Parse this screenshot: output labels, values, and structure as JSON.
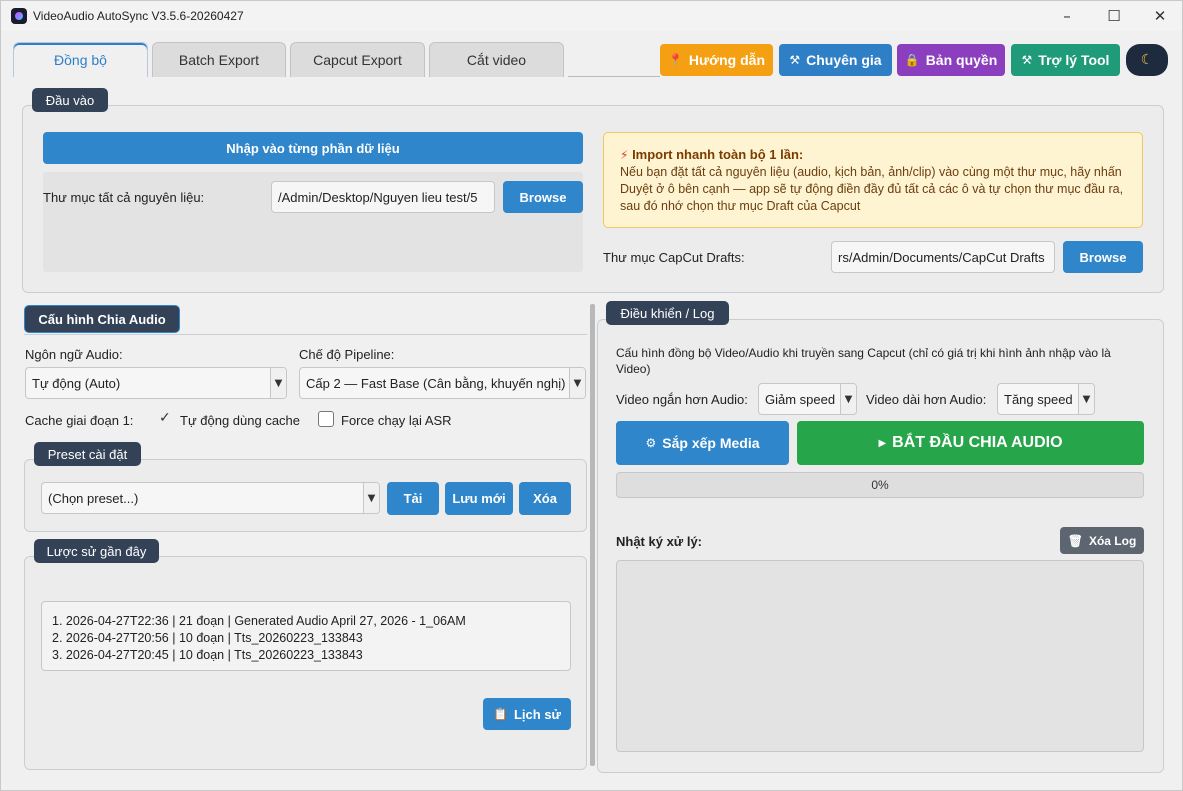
{
  "window": {
    "title": "VideoAudio AutoSync V3.5.6-20260427"
  },
  "tabs": [
    "Đồng bộ",
    "Batch Export",
    "Capcut Export",
    "Cắt video"
  ],
  "top_buttons": {
    "guide": {
      "label": "Hướng dẫn",
      "color": "#f5a012"
    },
    "expert": {
      "label": "Chuyên gia",
      "color": "#2f7fc6"
    },
    "license": {
      "label": "Bản quyền",
      "color": "#8b3fbf"
    },
    "assistant": {
      "label": "Trợ lý Tool",
      "color": "#1f9b7a"
    },
    "theme": {
      "icon": "moon-icon",
      "color": "#1e2a3e"
    }
  },
  "input_group": {
    "legend": "Đầu vào",
    "import_parts_button": "Nhập vào từng phần dữ liệu",
    "source_folder_label": "Thư mục tất cả nguyên liệu:",
    "source_folder_value": "/Admin/Desktop/Nguyen lieu test/5",
    "browse_label": "Browse",
    "notice_title": "Import nhanh toàn bộ 1 lần:",
    "notice_body": "Nếu bạn đặt tất cả nguyên liệu (audio, kịch bản, ảnh/clip) vào cùng một thư mục, hãy nhấn Duyệt ở ô bên cạnh — app sẽ tự động điền đầy đủ tất cả các ô và tự chọn thư mục đầu ra, sau đó nhớ chọn thư mục Draft của Capcut",
    "drafts_label": "Thư mục CapCut Drafts:",
    "drafts_value": "rs/Admin/Documents/CapCut Drafts",
    "drafts_browse_label": "Browse"
  },
  "audio_config": {
    "legend": "Cấu hình Chia Audio",
    "language_label": "Ngôn ngữ Audio:",
    "language_value": "Tự động (Auto)",
    "pipeline_label": "Chế độ Pipeline:",
    "pipeline_value": "Cấp 2 — Fast Base (Cân bằng, khuyến nghị)",
    "cache_label": "Cache giai đoạn 1:",
    "auto_cache_label": "Tự động dùng cache",
    "force_asr_label": "Force chạy lại ASR"
  },
  "preset": {
    "legend": "Preset cài đặt",
    "select_value": "(Chọn preset...)",
    "load_label": "Tải",
    "save_label": "Lưu mới",
    "delete_label": "Xóa"
  },
  "history": {
    "legend": "Lược sử gần đây",
    "items": [
      "1. 2026-04-27T22:36 | 21 đoạn | Generated Audio April 27, 2026 - 1_06AM",
      "2. 2026-04-27T20:56 | 10 đoạn | Tts_20260223_133843",
      "3. 2026-04-27T20:45 | 10 đoạn | Tts_20260223_133843"
    ],
    "history_button": "Lịch sử"
  },
  "control": {
    "legend": "Điều khiển / Log",
    "sync_note": "Cấu hình đồng bộ Video/Audio khi truyền sang Capcut (chỉ có giá trị khi hình ảnh nhập vào là Video)",
    "shorter_label": "Video ngắn hơn Audio:",
    "shorter_value": "Giảm speed",
    "longer_label": "Video dài hơn Audio:",
    "longer_value": "Tăng speed",
    "sort_media_label": "Sắp xếp Media",
    "start_label": "BẮT ĐẦU CHIA AUDIO",
    "progress": 0,
    "progress_text": "0%",
    "log_label": "Nhật ký xử lý:",
    "clear_log_label": "Xóa Log"
  },
  "colors": {
    "accent": "#2f86cb",
    "start": "#27a54a",
    "legend": "#334257"
  }
}
